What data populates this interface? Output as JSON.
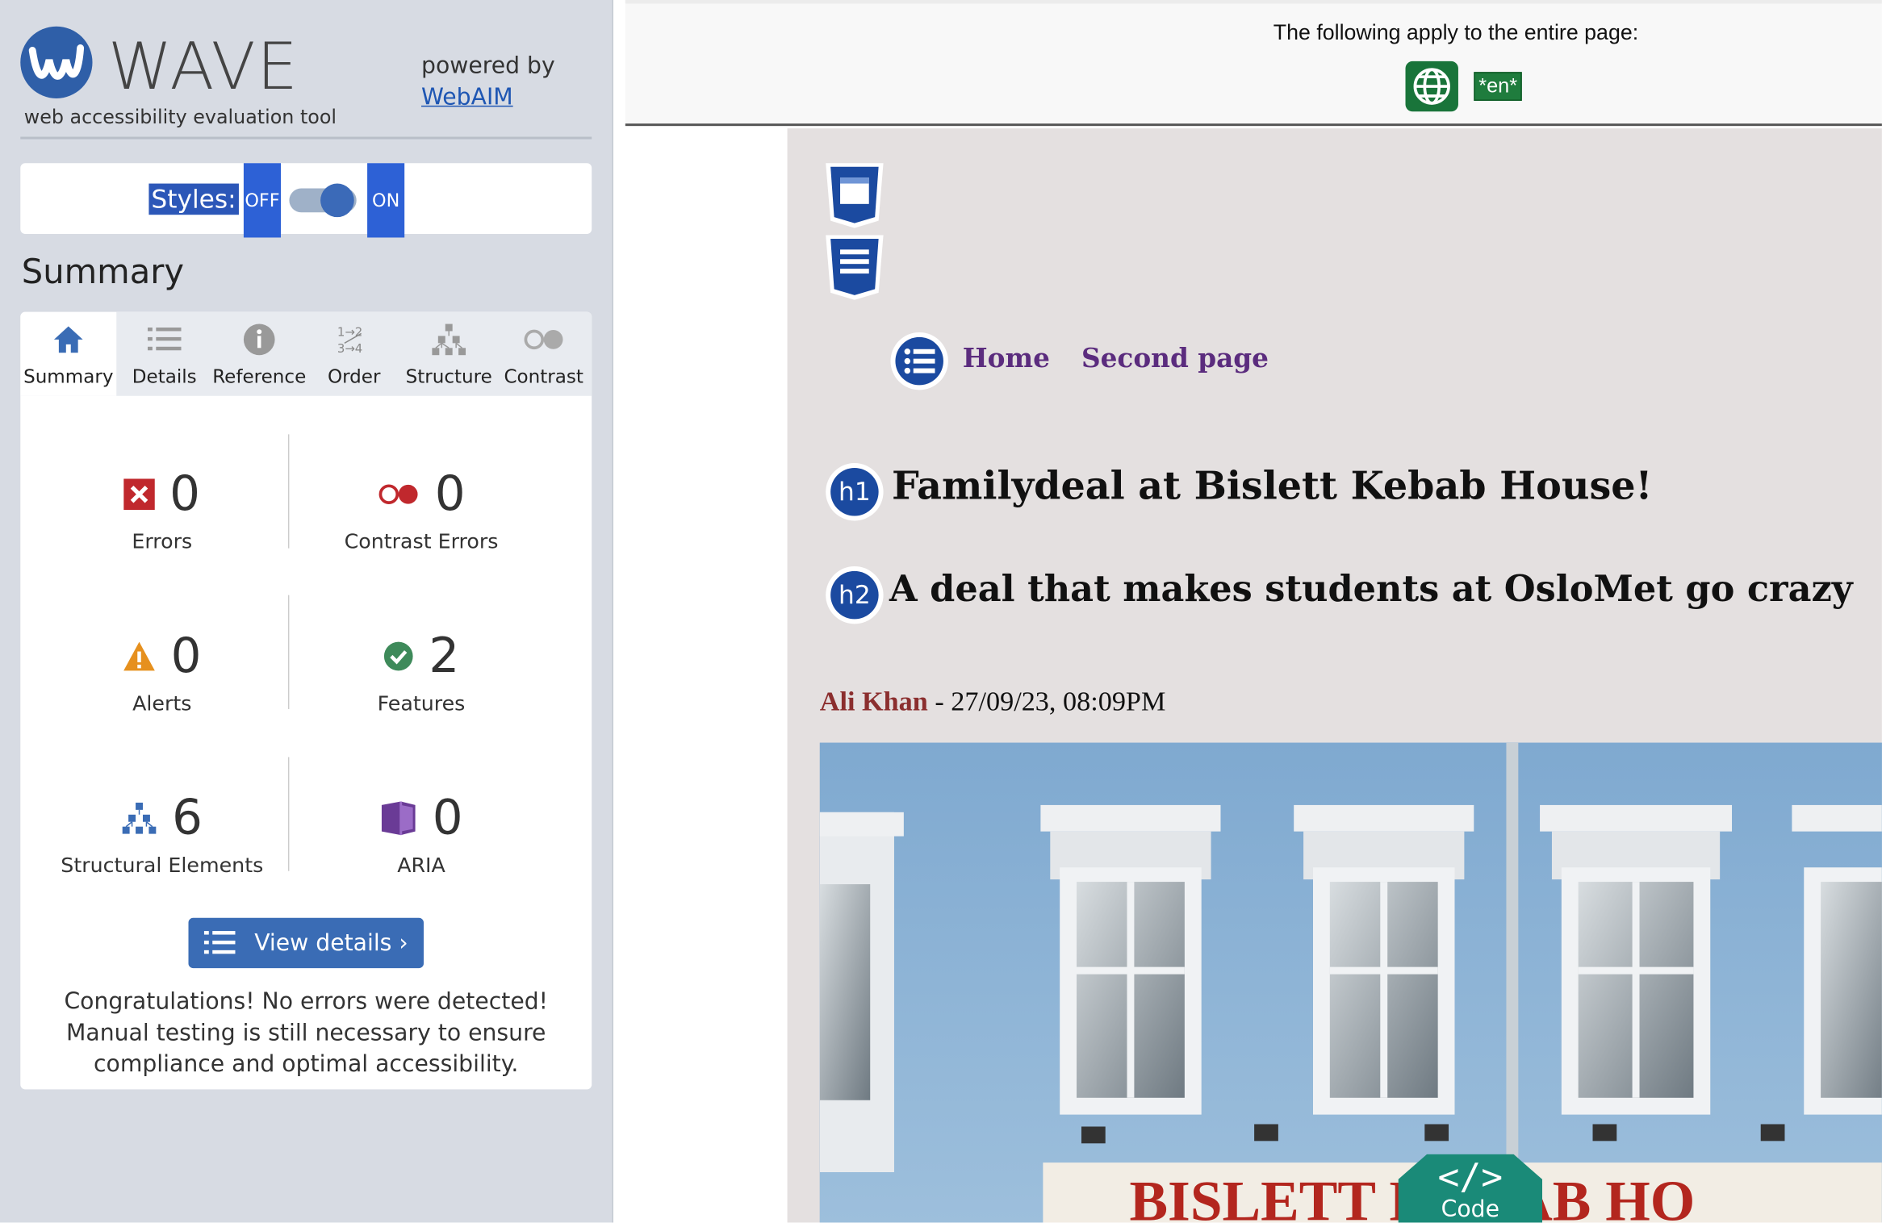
{
  "sidebar": {
    "app_name": "WAVE",
    "app_subtitle": "web accessibility evaluation tool",
    "powered_by": "powered by",
    "powered_link": "WebAIM",
    "styles_label": "Styles:",
    "styles_off": "OFF",
    "styles_on": "ON",
    "styles_state": "on",
    "summary_heading": "Summary",
    "tabs": [
      {
        "label": "Summary",
        "icon": "home-icon",
        "active": true
      },
      {
        "label": "Details",
        "icon": "list-icon"
      },
      {
        "label": "Reference",
        "icon": "info-icon"
      },
      {
        "label": "Order",
        "icon": "order-icon"
      },
      {
        "label": "Structure",
        "icon": "structure-icon"
      },
      {
        "label": "Contrast",
        "icon": "contrast-icon"
      }
    ],
    "stats": {
      "errors": {
        "value": "0",
        "label": "Errors",
        "icon": "error-icon",
        "color": "#c0282d"
      },
      "contrast_errors": {
        "value": "0",
        "label": "Contrast Errors",
        "icon": "contrast-error-icon",
        "color": "#c0282d"
      },
      "alerts": {
        "value": "0",
        "label": "Alerts",
        "icon": "alert-icon",
        "color": "#e6901e"
      },
      "features": {
        "value": "2",
        "label": "Features",
        "icon": "feature-check-icon",
        "color": "#3e8a5a"
      },
      "structural": {
        "value": "6",
        "label": "Structural Elements",
        "icon": "structure-tree-icon",
        "color": "#3a6cb5"
      },
      "aria": {
        "value": "0",
        "label": "ARIA",
        "icon": "aria-icon",
        "color": "#6a3b96"
      }
    },
    "view_details": "View details ›",
    "congrats": "Congratulations! No errors were detected! Manual testing is still necessary to ensure compliance and optimal accessibility."
  },
  "page": {
    "apply_text": "The following apply to the entire page:",
    "lang_tag": "*en*",
    "nav": [
      "Home",
      "Second page"
    ],
    "h1_badge": "h1",
    "h1": "Familydeal at Bislett Kebab House!",
    "h2_badge": "h2",
    "h2": "A deal that makes students at OsloMet go crazy",
    "author": "Ali Khan",
    "date": " - 27/09/23, 08:09PM",
    "sign_text": "BISLETT KEBAB HO",
    "code_button": "Code"
  },
  "colors": {
    "accent": "#2d61d6",
    "wave_blue": "#1b4aa0",
    "link_purple": "#5b2c7e",
    "author_red": "#8b2e2e"
  }
}
